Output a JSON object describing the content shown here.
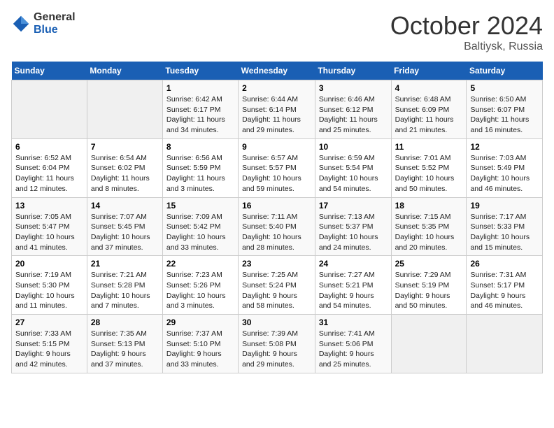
{
  "logo": {
    "general": "General",
    "blue": "Blue"
  },
  "title": {
    "month": "October 2024",
    "location": "Baltiysk, Russia"
  },
  "headers": [
    "Sunday",
    "Monday",
    "Tuesday",
    "Wednesday",
    "Thursday",
    "Friday",
    "Saturday"
  ],
  "weeks": [
    [
      {
        "day": "",
        "info": ""
      },
      {
        "day": "",
        "info": ""
      },
      {
        "day": "1",
        "info": "Sunrise: 6:42 AM\nSunset: 6:17 PM\nDaylight: 11 hours\nand 34 minutes."
      },
      {
        "day": "2",
        "info": "Sunrise: 6:44 AM\nSunset: 6:14 PM\nDaylight: 11 hours\nand 29 minutes."
      },
      {
        "day": "3",
        "info": "Sunrise: 6:46 AM\nSunset: 6:12 PM\nDaylight: 11 hours\nand 25 minutes."
      },
      {
        "day": "4",
        "info": "Sunrise: 6:48 AM\nSunset: 6:09 PM\nDaylight: 11 hours\nand 21 minutes."
      },
      {
        "day": "5",
        "info": "Sunrise: 6:50 AM\nSunset: 6:07 PM\nDaylight: 11 hours\nand 16 minutes."
      }
    ],
    [
      {
        "day": "6",
        "info": "Sunrise: 6:52 AM\nSunset: 6:04 PM\nDaylight: 11 hours\nand 12 minutes."
      },
      {
        "day": "7",
        "info": "Sunrise: 6:54 AM\nSunset: 6:02 PM\nDaylight: 11 hours\nand 8 minutes."
      },
      {
        "day": "8",
        "info": "Sunrise: 6:56 AM\nSunset: 5:59 PM\nDaylight: 11 hours\nand 3 minutes."
      },
      {
        "day": "9",
        "info": "Sunrise: 6:57 AM\nSunset: 5:57 PM\nDaylight: 10 hours\nand 59 minutes."
      },
      {
        "day": "10",
        "info": "Sunrise: 6:59 AM\nSunset: 5:54 PM\nDaylight: 10 hours\nand 54 minutes."
      },
      {
        "day": "11",
        "info": "Sunrise: 7:01 AM\nSunset: 5:52 PM\nDaylight: 10 hours\nand 50 minutes."
      },
      {
        "day": "12",
        "info": "Sunrise: 7:03 AM\nSunset: 5:49 PM\nDaylight: 10 hours\nand 46 minutes."
      }
    ],
    [
      {
        "day": "13",
        "info": "Sunrise: 7:05 AM\nSunset: 5:47 PM\nDaylight: 10 hours\nand 41 minutes."
      },
      {
        "day": "14",
        "info": "Sunrise: 7:07 AM\nSunset: 5:45 PM\nDaylight: 10 hours\nand 37 minutes."
      },
      {
        "day": "15",
        "info": "Sunrise: 7:09 AM\nSunset: 5:42 PM\nDaylight: 10 hours\nand 33 minutes."
      },
      {
        "day": "16",
        "info": "Sunrise: 7:11 AM\nSunset: 5:40 PM\nDaylight: 10 hours\nand 28 minutes."
      },
      {
        "day": "17",
        "info": "Sunrise: 7:13 AM\nSunset: 5:37 PM\nDaylight: 10 hours\nand 24 minutes."
      },
      {
        "day": "18",
        "info": "Sunrise: 7:15 AM\nSunset: 5:35 PM\nDaylight: 10 hours\nand 20 minutes."
      },
      {
        "day": "19",
        "info": "Sunrise: 7:17 AM\nSunset: 5:33 PM\nDaylight: 10 hours\nand 15 minutes."
      }
    ],
    [
      {
        "day": "20",
        "info": "Sunrise: 7:19 AM\nSunset: 5:30 PM\nDaylight: 10 hours\nand 11 minutes."
      },
      {
        "day": "21",
        "info": "Sunrise: 7:21 AM\nSunset: 5:28 PM\nDaylight: 10 hours\nand 7 minutes."
      },
      {
        "day": "22",
        "info": "Sunrise: 7:23 AM\nSunset: 5:26 PM\nDaylight: 10 hours\nand 3 minutes."
      },
      {
        "day": "23",
        "info": "Sunrise: 7:25 AM\nSunset: 5:24 PM\nDaylight: 9 hours\nand 58 minutes."
      },
      {
        "day": "24",
        "info": "Sunrise: 7:27 AM\nSunset: 5:21 PM\nDaylight: 9 hours\nand 54 minutes."
      },
      {
        "day": "25",
        "info": "Sunrise: 7:29 AM\nSunset: 5:19 PM\nDaylight: 9 hours\nand 50 minutes."
      },
      {
        "day": "26",
        "info": "Sunrise: 7:31 AM\nSunset: 5:17 PM\nDaylight: 9 hours\nand 46 minutes."
      }
    ],
    [
      {
        "day": "27",
        "info": "Sunrise: 7:33 AM\nSunset: 5:15 PM\nDaylight: 9 hours\nand 42 minutes."
      },
      {
        "day": "28",
        "info": "Sunrise: 7:35 AM\nSunset: 5:13 PM\nDaylight: 9 hours\nand 37 minutes."
      },
      {
        "day": "29",
        "info": "Sunrise: 7:37 AM\nSunset: 5:10 PM\nDaylight: 9 hours\nand 33 minutes."
      },
      {
        "day": "30",
        "info": "Sunrise: 7:39 AM\nSunset: 5:08 PM\nDaylight: 9 hours\nand 29 minutes."
      },
      {
        "day": "31",
        "info": "Sunrise: 7:41 AM\nSunset: 5:06 PM\nDaylight: 9 hours\nand 25 minutes."
      },
      {
        "day": "",
        "info": ""
      },
      {
        "day": "",
        "info": ""
      }
    ]
  ]
}
